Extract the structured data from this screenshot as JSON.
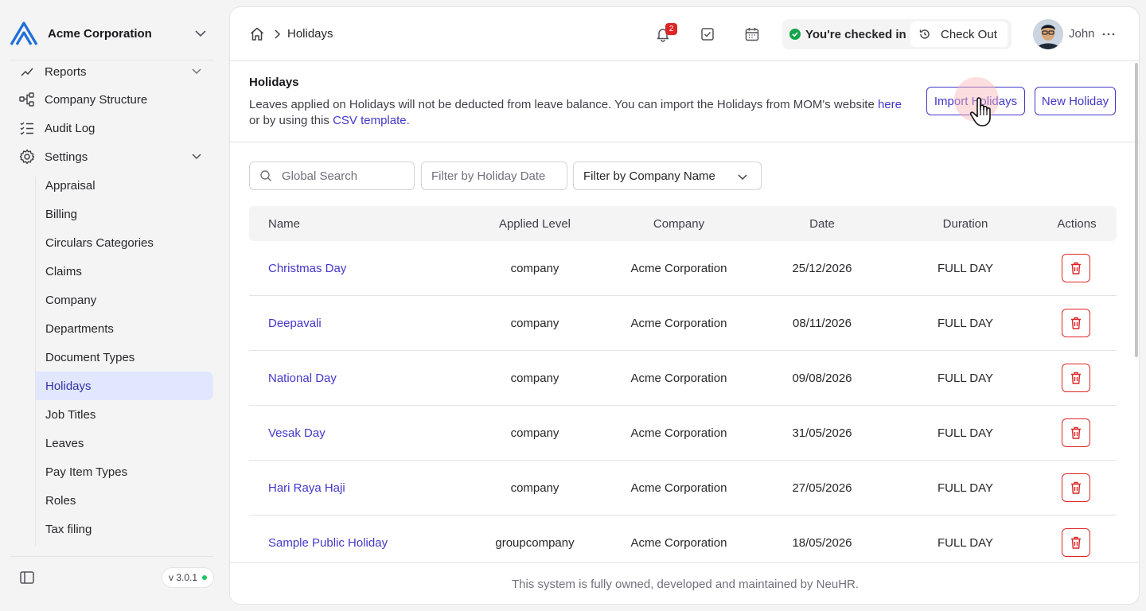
{
  "sidebar": {
    "company_name": "Acme Corporation",
    "items": [
      {
        "label": "Reports",
        "icon": "chart-icon"
      },
      {
        "label": "Company Structure",
        "icon": "org-chart-icon"
      },
      {
        "label": "Audit Log",
        "icon": "list-check-icon"
      },
      {
        "label": "Settings",
        "icon": "gear-icon"
      }
    ],
    "settings_items": [
      {
        "label": "Appraisal"
      },
      {
        "label": "Billing"
      },
      {
        "label": "Circulars Categories"
      },
      {
        "label": "Claims"
      },
      {
        "label": "Company"
      },
      {
        "label": "Departments"
      },
      {
        "label": "Document Types"
      },
      {
        "label": "Holidays",
        "active": true
      },
      {
        "label": "Job Titles"
      },
      {
        "label": "Leaves"
      },
      {
        "label": "Pay Item Types"
      },
      {
        "label": "Roles"
      },
      {
        "label": "Tax filing"
      }
    ],
    "version": "v 3.0.1"
  },
  "topbar": {
    "breadcrumb": "Holidays",
    "notification_count": "2",
    "checkin_status": "You're checked in",
    "checkout_label": "Check Out",
    "user_name": "John"
  },
  "page": {
    "title": "Holidays",
    "description_prefix": "Leaves applied on Holidays will not be deducted from leave balance. You can import the Holidays from MOM's website ",
    "here_link": "here",
    "description_middle": " or by using this ",
    "csv_link": "CSV template.",
    "import_label": "Import Holidays",
    "new_label": "New Holiday"
  },
  "filters": {
    "search_placeholder": "Global Search",
    "date_placeholder": "Filter by Holiday Date",
    "company_label": "Filter by Company Name"
  },
  "table": {
    "columns": {
      "name": "Name",
      "applied_level": "Applied Level",
      "company": "Company",
      "date": "Date",
      "duration": "Duration",
      "actions": "Actions"
    },
    "rows": [
      {
        "name": "Christmas Day",
        "applied_level": "company",
        "company": "Acme Corporation",
        "date": "25/12/2026",
        "duration": "FULL DAY"
      },
      {
        "name": "Deepavali",
        "applied_level": "company",
        "company": "Acme Corporation",
        "date": "08/11/2026",
        "duration": "FULL DAY"
      },
      {
        "name": "National Day",
        "applied_level": "company",
        "company": "Acme Corporation",
        "date": "09/08/2026",
        "duration": "FULL DAY"
      },
      {
        "name": "Vesak Day",
        "applied_level": "company",
        "company": "Acme Corporation",
        "date": "31/05/2026",
        "duration": "FULL DAY"
      },
      {
        "name": "Hari Raya Haji",
        "applied_level": "company",
        "company": "Acme Corporation",
        "date": "27/05/2026",
        "duration": "FULL DAY"
      },
      {
        "name": "Sample Public Holiday",
        "applied_level": "groupcompany",
        "company": "Acme Corporation",
        "date": "18/05/2026",
        "duration": "FULL DAY"
      }
    ]
  },
  "footer": {
    "text": "This system is fully owned, developed and maintained by NeuHR."
  },
  "colors": {
    "accent": "#4338ca",
    "active_bg": "#e0e7ff",
    "danger": "#dc2626",
    "success": "#16a34a"
  }
}
